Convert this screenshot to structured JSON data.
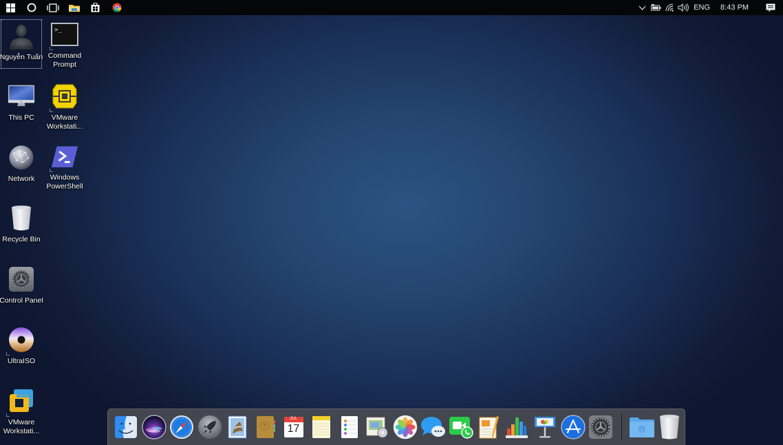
{
  "taskbar": {
    "left_buttons": [
      {
        "name": "start-button",
        "icon": "windows-logo-icon"
      },
      {
        "name": "cortana-button",
        "icon": "cortana-circle-icon"
      },
      {
        "name": "task-view-button",
        "icon": "task-view-icon"
      },
      {
        "name": "file-explorer-button",
        "icon": "folder-icon"
      },
      {
        "name": "store-button",
        "icon": "store-bag-icon"
      },
      {
        "name": "chrome-button",
        "icon": "chrome-icon"
      }
    ],
    "tray": {
      "show_hidden_icon": "chevron-up-icon",
      "battery_icon": "battery-icon",
      "wifi_icon": "wifi-icon",
      "volume_icon": "volume-icon",
      "language": "ENG",
      "clock": "8:43 PM",
      "notification_icon": "action-center-icon"
    }
  },
  "desktop": {
    "icons": [
      {
        "label": "Nguyễn Tuấn",
        "icon": "user-folder-icon",
        "selected": true
      },
      {
        "label": "Command Prompt",
        "icon": "command-prompt-icon"
      },
      {
        "label": "This PC",
        "icon": "computer-icon"
      },
      {
        "label": "VMware Workstati...",
        "icon": "vmware-yellow-icon"
      },
      {
        "label": "Network",
        "icon": "network-globe-icon"
      },
      {
        "label": "Windows PowerShell",
        "icon": "powershell-icon"
      },
      {
        "label": "Recycle Bin",
        "icon": "recycle-bin-icon"
      },
      {
        "label": "Control Panel",
        "icon": "control-panel-gear-icon"
      },
      {
        "label": "UltraISO",
        "icon": "ultraiso-disc-icon"
      },
      {
        "label": "VMware Workstati...",
        "icon": "vmware-blue-icon"
      }
    ]
  },
  "dock": {
    "items": [
      {
        "name": "Finder",
        "icon": "finder-icon"
      },
      {
        "name": "Siri",
        "icon": "siri-icon"
      },
      {
        "name": "Safari",
        "icon": "safari-compass-icon"
      },
      {
        "name": "Launchpad",
        "icon": "launchpad-rocket-icon"
      },
      {
        "name": "Mail",
        "icon": "mail-stamp-icon"
      },
      {
        "name": "Contacts",
        "icon": "contacts-book-icon"
      },
      {
        "name": "Calendar",
        "icon": "calendar-icon",
        "month": "JUL",
        "day": "17"
      },
      {
        "name": "Notes",
        "icon": "notes-icon"
      },
      {
        "name": "Reminders",
        "icon": "reminders-icon"
      },
      {
        "name": "Preview",
        "icon": "preview-icon"
      },
      {
        "name": "Photos",
        "icon": "photos-flower-icon"
      },
      {
        "name": "Messages",
        "icon": "messages-bubble-icon"
      },
      {
        "name": "FaceTime",
        "icon": "facetime-icon"
      },
      {
        "name": "Pages",
        "icon": "pages-icon"
      },
      {
        "name": "Numbers",
        "icon": "numbers-chart-icon"
      },
      {
        "name": "Keynote",
        "icon": "keynote-podium-icon"
      },
      {
        "name": "App Store",
        "icon": "app-store-icon"
      },
      {
        "name": "System Preferences",
        "icon": "system-preferences-gear-icon"
      }
    ],
    "stack_items": [
      {
        "name": "Downloads",
        "icon": "downloads-folder-icon"
      },
      {
        "name": "Trash",
        "icon": "trash-icon"
      }
    ]
  },
  "colors": {
    "taskbar": "#050608",
    "wallpaper_center": "#2d5384",
    "wallpaper_edge": "#0e1630",
    "dock": "#484a50"
  }
}
